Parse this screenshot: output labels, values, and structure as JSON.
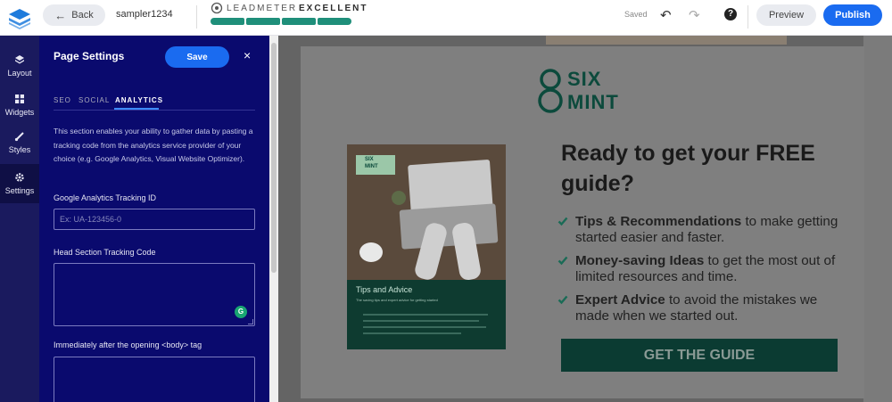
{
  "topbar": {
    "back_label": "Back",
    "page_name": "sampler1234",
    "leadmeter_label": "LEADMETER",
    "leadmeter_grade": "EXCELLENT",
    "leadmeter_segments": 4,
    "saved_label": "Saved",
    "help_label": "?",
    "preview_label": "Preview",
    "publish_label": "Publish"
  },
  "rail": {
    "items": [
      {
        "label": "Layout",
        "icon": "layers-icon"
      },
      {
        "label": "Widgets",
        "icon": "grid-icon"
      },
      {
        "label": "Styles",
        "icon": "brush-icon"
      },
      {
        "label": "Settings",
        "icon": "gear-icon"
      }
    ],
    "active": "Settings"
  },
  "panel": {
    "title": "Page Settings",
    "save_label": "Save",
    "close_label": "×",
    "tabs": [
      "SEO",
      "SOCIAL",
      "ANALYTICS"
    ],
    "active_tab": "ANALYTICS",
    "description": "This section enables your ability to gather data by pasting a tracking code from the analytics service provider of your choice (e.g. Google Analytics, Visual Website Optimizer).",
    "ga_label": "Google Analytics Tracking ID",
    "ga_placeholder": "Ex: UA-123456-0",
    "ga_value": "",
    "head_label": "Head Section Tracking Code",
    "body_label": "Immediately after the opening <body> tag",
    "grammarly": "G"
  },
  "landing": {
    "logo_top": "SIX",
    "logo_bottom": "MINT",
    "book_badge_top": "SIX",
    "book_badge_bottom": "MINT",
    "book_footer_title": "Tips and Advice",
    "book_footer_sub": "The saving tips and expert advice for getting started",
    "headline": "Ready to get your FREE guide?",
    "bullets": [
      {
        "bold": "Tips & Recommendations",
        "rest": " to make getting started easier and faster."
      },
      {
        "bold": "Money-saving Ideas",
        "rest": " to get the most out of limited resources and time."
      },
      {
        "bold": "Expert Advice",
        "rest": " to avoid the mistakes we made when we started out."
      }
    ],
    "cta_label": "GET THE GUIDE",
    "colors": {
      "brand_green": "#0c4a3c",
      "check_green": "#1a6b56"
    }
  },
  "colors": {
    "accent_blue": "#1a6bf0",
    "panel_bg": "#0a0a6e",
    "rail_bg": "#1a1a5e",
    "leadmeter_green": "#1f8f7a"
  }
}
